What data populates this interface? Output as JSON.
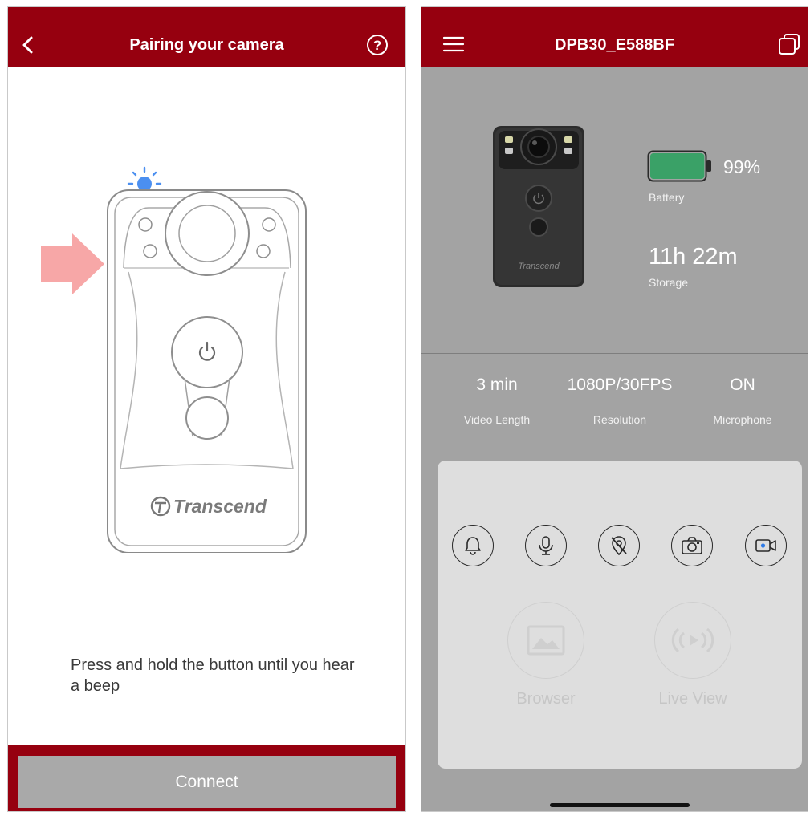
{
  "left_screen": {
    "header": {
      "title": "Pairing your camera",
      "back_icon": "chevron-left-icon",
      "help_icon": "question-circle-icon"
    },
    "illustration": {
      "brand": "Transcend",
      "power_symbol": "⏻"
    },
    "instruction": "Press and hold the button until you hear a beep",
    "connect_label": "Connect",
    "colors": {
      "accent": "#96000f",
      "arrow": "#f7a7a7",
      "led": "#4b8ff0"
    }
  },
  "right_screen": {
    "header": {
      "title": "DPB30_E588BF",
      "menu_icon": "hamburger-menu-icon",
      "copy_icon": "copy-icon"
    },
    "device": {
      "battery_value": "99%",
      "battery_level": 0.99,
      "battery_label": "Battery",
      "storage_value": "11h 22m",
      "storage_label": "Storage",
      "brand": "Transcend"
    },
    "stats": [
      {
        "value": "3 min",
        "label": "Video Length"
      },
      {
        "value": "1080P/30FPS",
        "label": "Resolution"
      },
      {
        "value": "ON",
        "label": "Microphone"
      }
    ],
    "controls": [
      {
        "icon": "bell-icon"
      },
      {
        "icon": "microphone-icon"
      },
      {
        "icon": "location-off-icon"
      },
      {
        "icon": "camera-icon"
      },
      {
        "icon": "video-record-icon"
      }
    ],
    "actions": [
      {
        "label": "Browser",
        "icon": "image-gallery-icon"
      },
      {
        "label": "Live View",
        "icon": "live-stream-icon"
      }
    ],
    "colors": {
      "accent": "#96000f",
      "battery": "#3aa167",
      "background": "#a3a3a3"
    }
  }
}
